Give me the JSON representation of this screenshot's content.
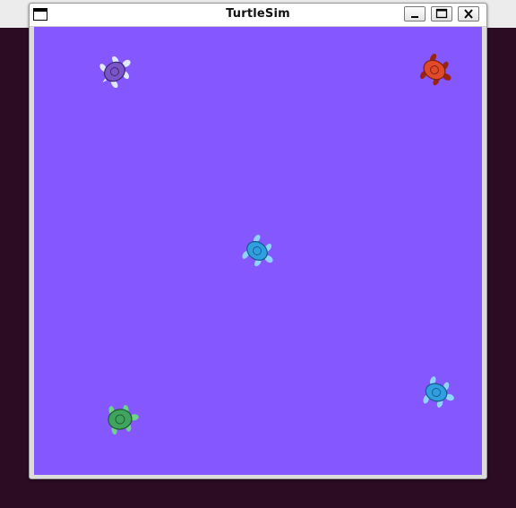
{
  "window": {
    "title": "TurtleSim",
    "controls": [
      "minimize",
      "maximize",
      "close"
    ]
  },
  "canvas": {
    "background": "#8457ff"
  },
  "turtles": [
    {
      "color": "purple",
      "shell": "#7a55c8",
      "skin": "#dfe8ff"
    },
    {
      "color": "red",
      "shell": "#e04a2a",
      "skin": "#9a2412"
    },
    {
      "color": "blue",
      "shell": "#2f9fe0",
      "skin": "#8fd4ff"
    },
    {
      "color": "blue",
      "shell": "#2f9fe0",
      "skin": "#8fd4ff"
    },
    {
      "color": "green",
      "shell": "#3fa45e",
      "skin": "#6fd18c"
    }
  ]
}
